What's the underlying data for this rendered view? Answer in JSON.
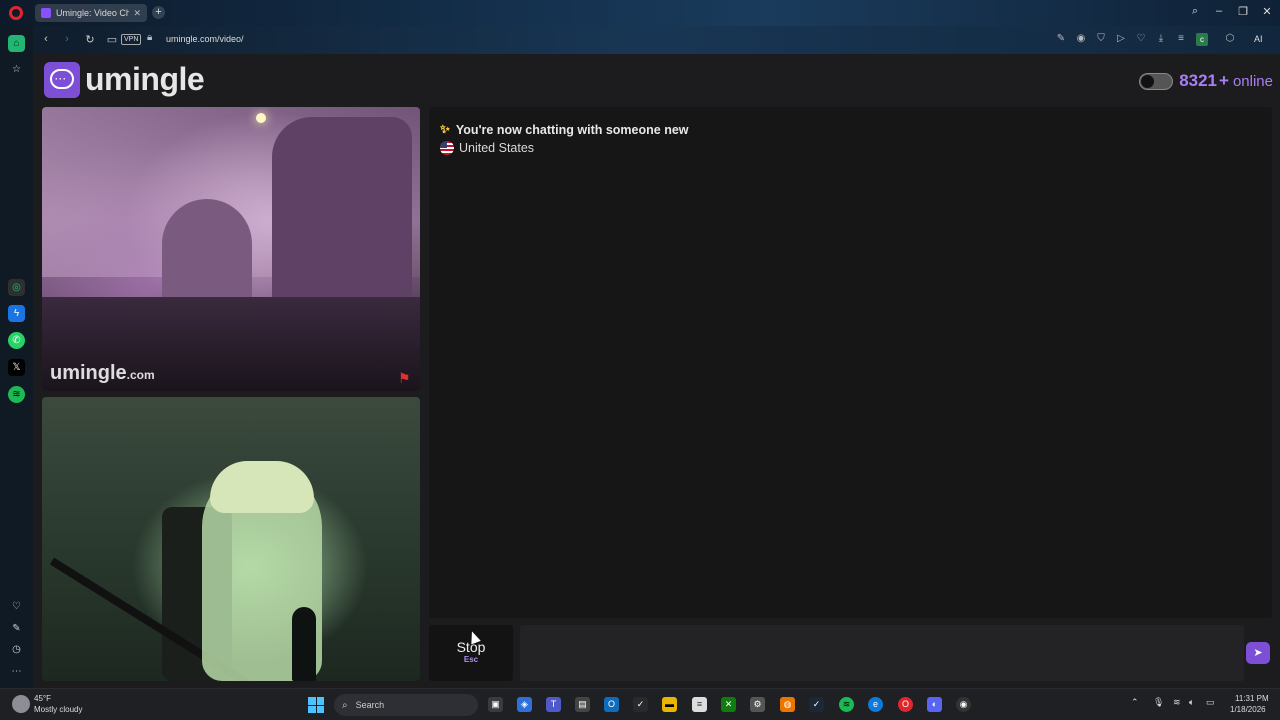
{
  "browser": {
    "tab_title": "Umingle: Video Chat",
    "new_tab_symbol": "+",
    "url": "umingle.com/video/",
    "vpn_label": "VPN",
    "ai_label": "AI",
    "extension_badge": "c"
  },
  "header": {
    "logo_text": "umingle",
    "online_count": "8321",
    "online_plus": "+",
    "online_label": "online"
  },
  "remote_video": {
    "watermark": "umingle",
    "watermark_domain": ".com"
  },
  "chat": {
    "status_message": "You're now chatting with someone new",
    "country": "United States"
  },
  "controls": {
    "stop_label": "Stop",
    "stop_key": "Esc",
    "message_placeholder": ""
  },
  "taskbar": {
    "weather_temp": "45°F",
    "weather_desc": "Mostly cloudy",
    "search_label": "Search",
    "time": "11:31 PM",
    "date": "1/18/2026"
  },
  "colors": {
    "brand": "#7d4fd6",
    "online_text": "#a77ff2",
    "page_bg": "#1c1c1e",
    "chat_bg": "#161617"
  }
}
